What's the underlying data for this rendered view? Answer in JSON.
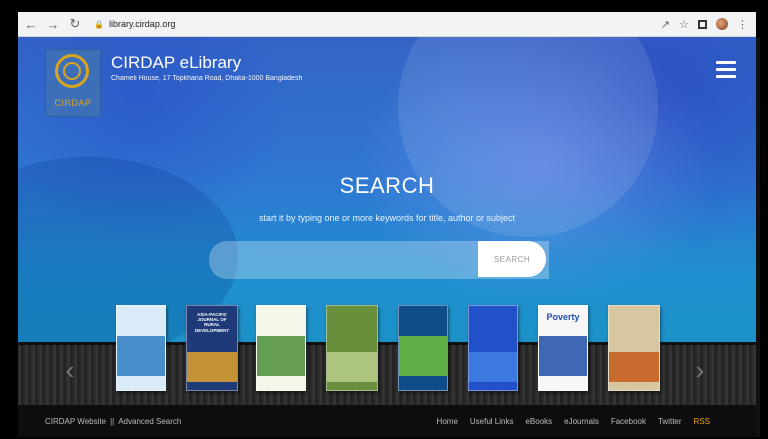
{
  "browser": {
    "back_icon": "arrow-left-icon",
    "forward_icon": "arrow-right-icon",
    "reload_icon": "reload-icon",
    "url": "library.cirdap.org"
  },
  "header": {
    "logo_text": "CIRDAP",
    "title": "CIRDAP eLibrary",
    "address": "Chameli House, 17 Topkhana Road, Dhaka-1000 Bangladesh",
    "menu_icon": "hamburger-icon"
  },
  "search": {
    "heading": "SEARCH",
    "subtitle": "start it by typing one or more keywords for title, author or subject",
    "input_value": "",
    "button_label": "SEARCH"
  },
  "carousel": {
    "prev_icon": "chevron-left-icon",
    "next_icon": "chevron-right-icon",
    "books": [
      {
        "title": "",
        "color": "#d9ecf7",
        "accent": "#2f7fc4"
      },
      {
        "title": "ASIA-PACIFIC JOURNAL OF RURAL DEVELOPMENT",
        "color": "#1f3a78",
        "accent": "#e0a22a"
      },
      {
        "title": "",
        "color": "#f3f6e8",
        "accent": "#4a8f3a"
      },
      {
        "title": "",
        "color": "#6a8f3c",
        "accent": "#b8cf8a"
      },
      {
        "title": "",
        "color": "#0f4c8a",
        "accent": "#6fbf3a"
      },
      {
        "title": "",
        "color": "#2150c8",
        "accent": "#3f7fe4"
      },
      {
        "title": "Poverty",
        "color": "#f7f7f7",
        "accent": "#1e4fa8"
      },
      {
        "title": "",
        "color": "#d8c6a0",
        "accent": "#c55a1a"
      }
    ]
  },
  "footer": {
    "website_link": "CIRDAP Website",
    "separator": "||",
    "advanced_search_link": "Advanced Search",
    "links": [
      "Home",
      "Useful Links",
      "eBooks",
      "eJournals",
      "Facebook",
      "Twitter"
    ],
    "rss": "RSS"
  }
}
